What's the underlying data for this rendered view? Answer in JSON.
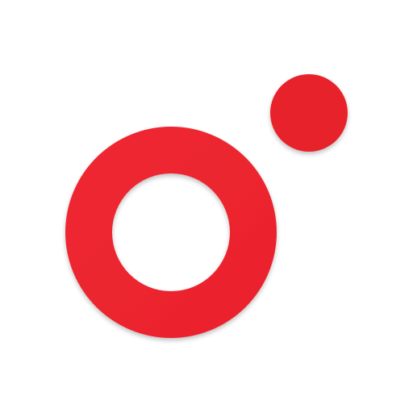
{
  "logo": {
    "icon": "ring-and-dot-logo-icon",
    "colors": {
      "background": "#ffffff",
      "ring": "#e8202b",
      "dot": "#e8202b",
      "ring_highlight": "#f02a33"
    }
  }
}
